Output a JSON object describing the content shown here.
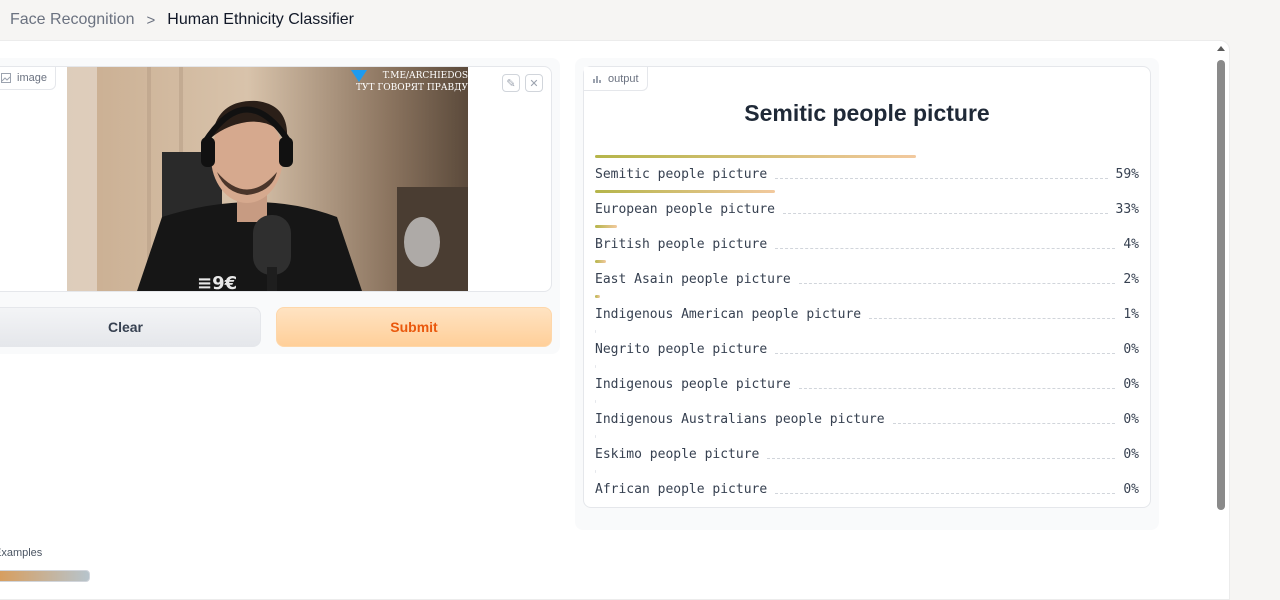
{
  "breadcrumb": {
    "parent": "Face Recognition",
    "separator": ">",
    "current": "Human Ethnicity Classifier"
  },
  "input": {
    "label": "image",
    "watermark_line1": "T.ME/ARCHIEDOS",
    "watermark_line2": "ТУТ ГОВОРЯТ ПРАВДУ",
    "edit_icon": "pencil-icon",
    "clear_icon": "close-icon"
  },
  "buttons": {
    "clear": "Clear",
    "submit": "Submit"
  },
  "examples": {
    "label": "Examples"
  },
  "output": {
    "label": "output",
    "title": "Semitic people picture",
    "confidences": [
      {
        "label": "Semitic people picture",
        "value": "59%",
        "fraction": 0.59
      },
      {
        "label": "European people picture",
        "value": "33%",
        "fraction": 0.33
      },
      {
        "label": "British people picture",
        "value": "4%",
        "fraction": 0.04
      },
      {
        "label": "East Asain people picture",
        "value": "2%",
        "fraction": 0.02
      },
      {
        "label": "Indigenous American people picture",
        "value": "1%",
        "fraction": 0.01
      },
      {
        "label": "Negrito people picture",
        "value": "0%",
        "fraction": 0.0
      },
      {
        "label": "Indigenous people picture",
        "value": "0%",
        "fraction": 0.0
      },
      {
        "label": "Indigenous Australians people picture",
        "value": "0%",
        "fraction": 0.0
      },
      {
        "label": "Eskimo people picture",
        "value": "0%",
        "fraction": 0.0
      },
      {
        "label": "African people picture",
        "value": "0%",
        "fraction": 0.0
      }
    ]
  },
  "colors": {
    "submit_text": "#ea580c",
    "bar_start": "#b5b54a",
    "bar_end": "#f2c99e"
  }
}
